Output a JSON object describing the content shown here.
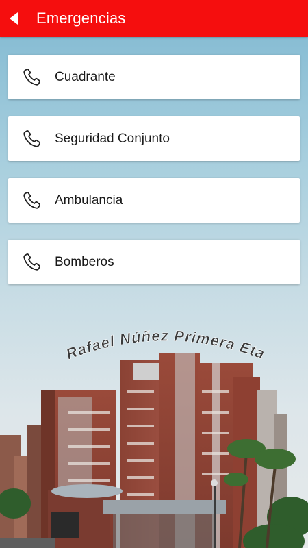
{
  "header": {
    "title": "Emergencias",
    "background_color": "#f50e0e",
    "back_icon": "arrow-left-icon"
  },
  "contacts": [
    {
      "label": "Cuadrante",
      "icon": "phone-icon"
    },
    {
      "label": "Seguridad Conjunto",
      "icon": "phone-icon"
    },
    {
      "label": "Ambulancia",
      "icon": "phone-icon"
    },
    {
      "label": "Bomberos",
      "icon": "phone-icon"
    }
  ],
  "background": {
    "caption": "Rafael Núñez  Primera Etapa",
    "scene": "apartment-buildings-photo"
  }
}
